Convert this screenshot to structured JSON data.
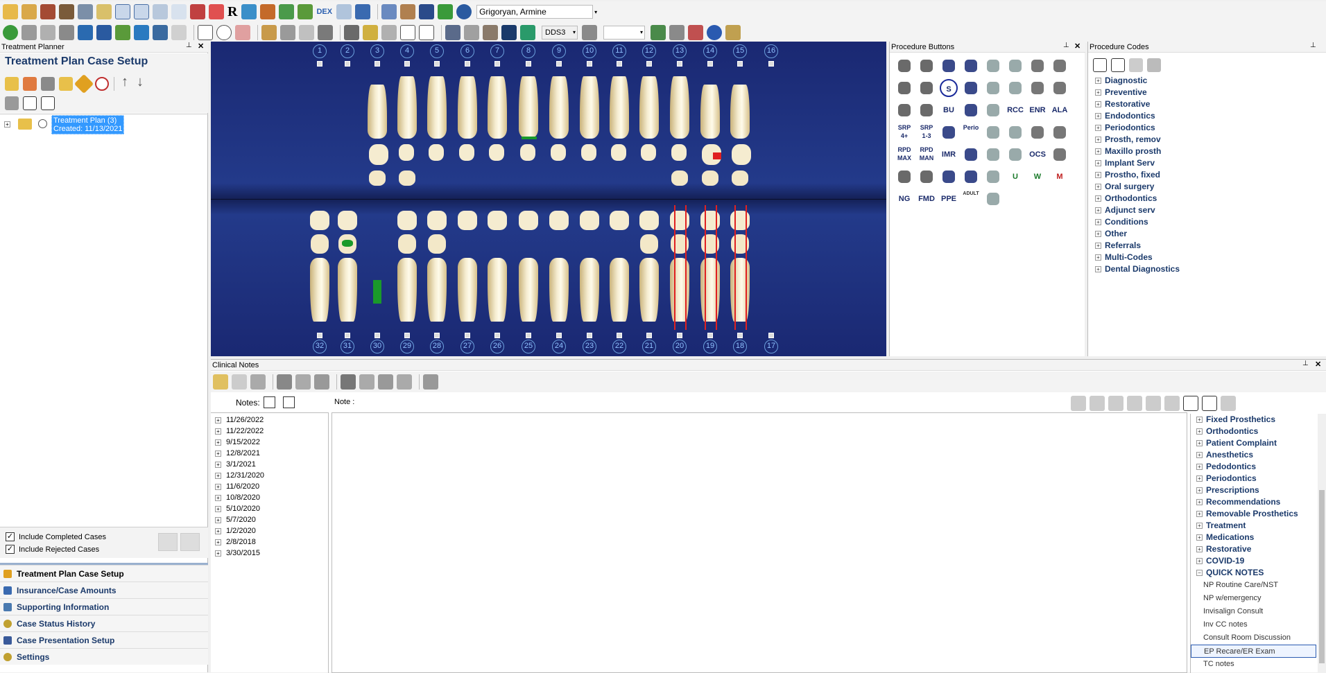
{
  "toolbar1": {
    "patient_name": "Grigoryan, Armine",
    "dex_label": "DEX",
    "r_label": "R"
  },
  "toolbar2": {
    "provider_value": "DDS3"
  },
  "treatment_planner": {
    "pane_title": "Treatment Planner",
    "header": "Treatment Plan Case Setup",
    "tree": [
      {
        "line1": "Treatment Plan (3)",
        "line2": "Created: 11/13/2021"
      }
    ],
    "include_completed": "Include Completed Cases",
    "include_rejected": "Include Rejected Cases",
    "nav": [
      "Treatment Plan Case Setup",
      "Insurance/Case Amounts",
      "Supporting Information",
      "Case Status History",
      "Case Presentation Setup",
      "Settings"
    ]
  },
  "chart": {
    "upper_teeth": [
      "1",
      "2",
      "3",
      "4",
      "5",
      "6",
      "7",
      "8",
      "9",
      "10",
      "11",
      "12",
      "13",
      "14",
      "15",
      "16"
    ],
    "lower_teeth": [
      "32",
      "31",
      "30",
      "29",
      "28",
      "27",
      "26",
      "25",
      "24",
      "23",
      "22",
      "21",
      "20",
      "19",
      "18",
      "17"
    ]
  },
  "procedure_buttons": {
    "pane_title": "Procedure Buttons",
    "labeled": [
      "SRP 4+",
      "SRP 1-3",
      "RCC",
      "ENR",
      "ALA",
      "RPD MAX",
      "RPD MAN",
      "IMR",
      "OCS",
      "Perio",
      "BU",
      "S",
      "NG",
      "FMD",
      "PPE",
      "M",
      "U",
      "W",
      "ADULT"
    ]
  },
  "procedure_codes": {
    "pane_title": "Procedure Codes",
    "items": [
      "Diagnostic",
      "Preventive",
      "Restorative",
      "Endodontics",
      "Periodontics",
      "Prosth, remov",
      "Maxillo prosth",
      "Implant Serv",
      "Prostho, fixed",
      "Oral surgery",
      "Orthodontics",
      "Adjunct serv",
      "Conditions",
      "Other",
      "Referrals",
      "Multi-Codes",
      "Dental Diagnostics"
    ]
  },
  "clinical_notes": {
    "pane_title": "Clinical Notes",
    "notes_label": "Notes:",
    "note_label": "Note :",
    "dates": [
      "11/26/2022",
      "11/22/2022",
      "9/15/2022",
      "12/8/2021",
      "3/1/2021",
      "12/31/2020",
      "11/6/2020",
      "10/8/2020",
      "5/10/2020",
      "5/7/2020",
      "1/2/2020",
      "2/8/2018",
      "3/30/2015"
    ]
  },
  "quick_notes": {
    "groups": [
      "Fixed Prosthetics",
      "Orthodontics",
      "Patient Complaint",
      "Anesthetics",
      "Pedodontics",
      "Periodontics",
      "Prescriptions",
      "Recommendations",
      "Removable Prosthetics",
      "Treatment",
      "Medications",
      "Restorative",
      "COVID-19",
      "QUICK NOTES"
    ],
    "items": [
      "NP Routine Care/NST",
      "NP w/emergency",
      "Invisalign Consult",
      "Inv CC notes",
      "Consult Room Discussion",
      "EP Recare/ER Exam",
      "TC notes"
    ],
    "selected_index": 5
  },
  "colors": {
    "chart_bg": "#1b2a6b",
    "accent_blue": "#1b3a6b",
    "selection": "#3399ff",
    "red_marker": "#e02020"
  }
}
